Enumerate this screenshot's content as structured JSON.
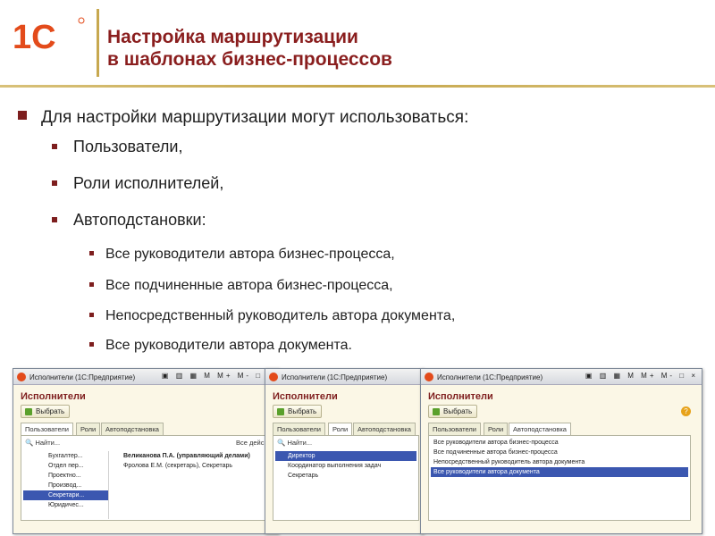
{
  "header": {
    "logo_text": "1С",
    "title_line1": "Настройка маршрутизации",
    "title_line2": "в шаблонах бизнес-процессов"
  },
  "bullets": {
    "main": "Для настройки маршрутизации могут использоваться:",
    "sub": [
      "Пользователи,",
      "Роли исполнителей,",
      "Автоподстановки:"
    ],
    "subsub": [
      "Все руководители автора бизнес-процесса,",
      "Все подчиненные автора бизнес-процесса,",
      "Непосредственный руководитель автора документа,",
      "Все руководители автора документа."
    ]
  },
  "windows": [
    {
      "titlebar": "Исполнители  (1С:Предприятие)",
      "buttons": "▣ ▥ ▦ M M+ M- □ ×",
      "heading": "Исполнители",
      "pick_label": "Выбрать",
      "tabs": [
        "Пользователи",
        "Роли",
        "Автоподстановка"
      ],
      "active_tab": 0,
      "find_label": "Найти...",
      "find_right": "Все дейс",
      "tree": [
        "Бухгалтер...",
        "Отдел пер...",
        "Проектно...",
        "Производ...",
        "Секретари...",
        "Юридичес..."
      ],
      "tree_selected": 4,
      "users": [
        "Великанова П.А. (управляющий делами)",
        "Фролова Е.М. (секретарь), Секретарь"
      ]
    },
    {
      "titlebar": "Исполнители  (1С:Предприятие)",
      "buttons": "▣ ▥ ▦ M M+ M- □ ×",
      "heading": "Исполнители",
      "pick_label": "Выбрать",
      "tabs": [
        "Пользователи",
        "Роли",
        "Автоподстановка"
      ],
      "active_tab": 1,
      "find_label": "Найти...",
      "roles": [
        "Директор",
        "Координатор выполнения задач",
        "Секретарь"
      ],
      "roles_selected": 0
    },
    {
      "titlebar": "Исполнители  (1С:Предприятие)",
      "buttons": "▣ ▥ ▦ M M+ M- □ ×",
      "heading": "Исполнители",
      "pick_label": "Выбрать",
      "help": "?",
      "tabs": [
        "Пользователи",
        "Роли",
        "Автоподстановка"
      ],
      "active_tab": 2,
      "auto": [
        "Все руководители автора бизнес-процесса",
        "Все подчиненные автора бизнес-процесса",
        "Непосредственный руководитель автора документа",
        "Все руководители автора документа"
      ],
      "auto_selected": 3
    }
  ],
  "colors": {
    "title": "#8a1e1e",
    "accent_line": "#c7a84f",
    "bullet": "#7d1e1e",
    "selection": "#3b57b0",
    "logo": "#e34b1b"
  }
}
